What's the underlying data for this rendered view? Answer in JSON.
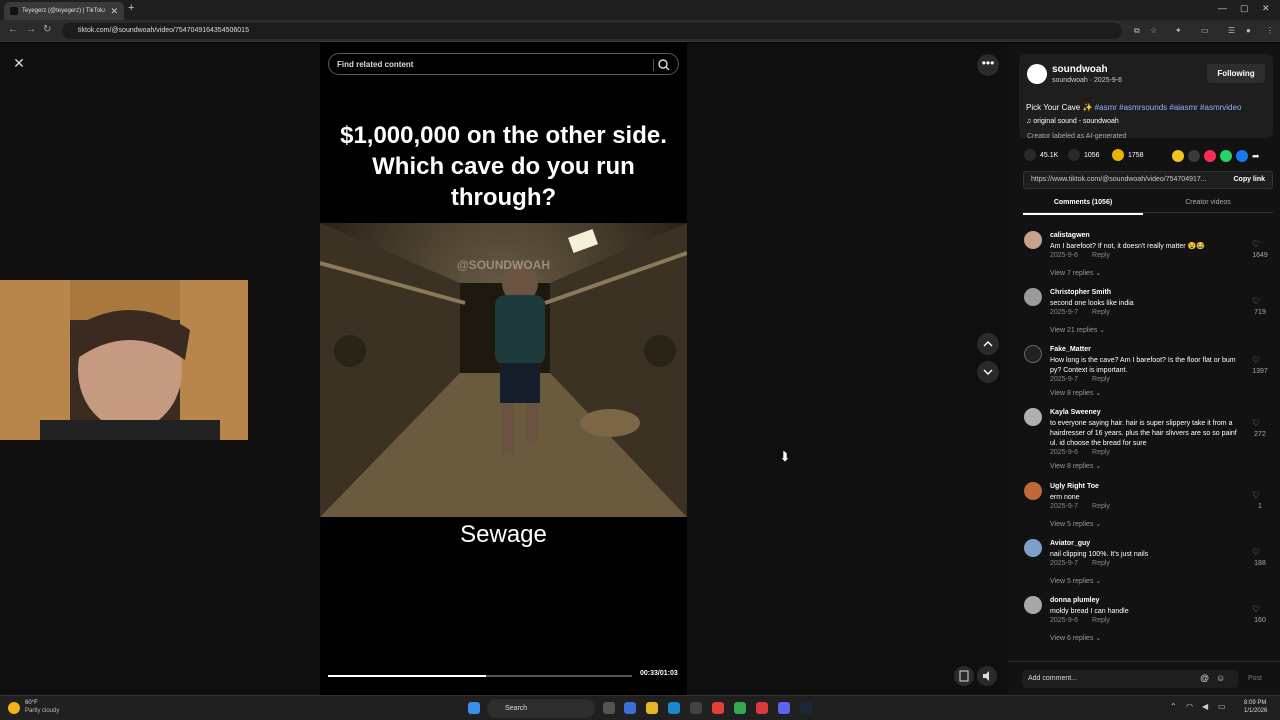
{
  "browser": {
    "tab_title": "Teyegerz (@teyegerz) | TikTok",
    "url": "tiktok.com/@soundwoah/video/7547049164354506015"
  },
  "video": {
    "search_placeholder": "Find related content",
    "caption": "$1,000,000 on the other side. Which cave do you run through?",
    "watermark": "@SOUNDWOAH",
    "label": "Sewage",
    "time": "00:33/01:03",
    "progress": 0.52
  },
  "post": {
    "author": "soundwoah",
    "author_sub": "soundwoah · 2025-9-6",
    "follow_label": "Following",
    "desc_text": "Pick Your Cave ✨",
    "hashtags": "#asmr #asmrsounds #aiasmr #asmrvideo",
    "sound": "♫  original sound - soundwoah",
    "ai_label": "Creator labeled as AI-generated",
    "likes": "45.1K",
    "comments_count": "1056",
    "saves": "1758",
    "link": "https://www.tiktok.com/@soundwoah/video/754704917...",
    "copy_label": "Copy link",
    "tab_comments": "Comments (1056)",
    "tab_creator": "Creator videos"
  },
  "comments": [
    {
      "user": "calistagwen",
      "text": "Am I barefoot? If not, it doesn't really matter 😵😂",
      "date": "2025-9-6",
      "reply": "Reply",
      "view": "View 7 replies ⌄",
      "likes": "1649"
    },
    {
      "user": "Christopher Smith",
      "text": "second one looks like india",
      "date": "2025-9-7",
      "reply": "Reply",
      "view": "View 21 replies ⌄",
      "likes": "719"
    },
    {
      "user": "Fake_Matter",
      "text": "How long is the cave? Am I barefoot? Is the floor flat or bum py? Context is important.",
      "date": "2025-9-7",
      "reply": "Reply",
      "view": "View 8 replies ⌄",
      "likes": "1397"
    },
    {
      "user": "Kayla Sweeney",
      "text": "to everyone saying hair. hair is super slippery take it from a hairdresser of 16 years. plus the hair slivvers are so so painf ul. id choose the bread for sure",
      "date": "2025-9-6",
      "reply": "Reply",
      "view": "View 8 replies ⌄",
      "likes": "272"
    },
    {
      "user": "Ugly Right Toe",
      "text": "erm none",
      "date": "2025-9-7",
      "reply": "Reply",
      "view": "View 5 replies ⌄",
      "likes": "1"
    },
    {
      "user": "Aviator_guy",
      "text": "nail clipping 100%. It's just nails",
      "date": "2025-9-7",
      "reply": "Reply",
      "view": "View 5 replies ⌄",
      "likes": "188"
    },
    {
      "user": "donna plumley",
      "text": "moldy bread I can handle",
      "date": "2025-9-6",
      "reply": "Reply",
      "view": "View 6 replies ⌄",
      "likes": "160"
    }
  ],
  "comment_input": {
    "placeholder": "Add comment...",
    "post_label": "Post"
  },
  "taskbar": {
    "weather_temp": "60°F",
    "weather_desc": "Partly cloudy",
    "search": "Search",
    "time": "8:09 PM",
    "date": "1/1/2026"
  }
}
